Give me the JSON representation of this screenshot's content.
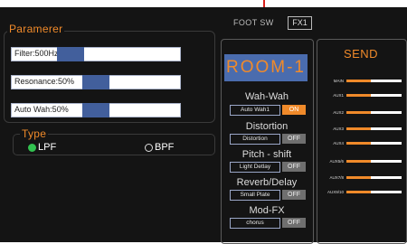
{
  "params": {
    "legend": "Paramerer",
    "sliders": [
      {
        "label": "Filter:500Hz",
        "value": 0.35
      },
      {
        "label": "Resonance:50%",
        "value": 0.5
      },
      {
        "label": "Auto Wah:50%",
        "value": 0.5
      }
    ]
  },
  "type": {
    "legend": "Type",
    "options": [
      {
        "label": "LPF",
        "selected": true
      },
      {
        "label": "BPF",
        "selected": false
      }
    ]
  },
  "top": {
    "foot_sw": "FOOT SW",
    "fx_button": "FX1"
  },
  "preset": {
    "name": "ROOM-1"
  },
  "effects": [
    {
      "title": "Wah-Wah",
      "name": "Auto Wah1",
      "state": "ON",
      "on": true
    },
    {
      "title": "Distortion",
      "name": "Distortion",
      "state": "OFF",
      "on": false
    },
    {
      "title": "Pitch - shift",
      "name": "Light Detlay",
      "state": "OFF",
      "on": false
    },
    {
      "title": "Reverb/Delay",
      "name": "Small Plate",
      "state": "OFF",
      "on": false
    },
    {
      "title": "Mod-FX",
      "name": "chorus",
      "state": "OFF",
      "on": false
    }
  ],
  "send": {
    "title": "SEND",
    "rows": [
      {
        "label": "MAIN",
        "value": 0.45
      },
      {
        "label": "AUX1",
        "value": 0.45
      },
      {
        "label": "AUX2",
        "value": 0.45
      },
      {
        "label": "AUX3",
        "value": 0.45
      },
      {
        "label": "AUX4",
        "value": 0.45
      },
      {
        "label": "AUX5/6",
        "value": 0.45
      },
      {
        "label": "AUX7/8",
        "value": 0.45
      },
      {
        "label": "AUX9/10",
        "value": 0.45
      }
    ]
  },
  "colors": {
    "accent": "#f08a2a",
    "panel": "#141414",
    "thumb": "#425f9c",
    "on_green": "#32c250"
  }
}
